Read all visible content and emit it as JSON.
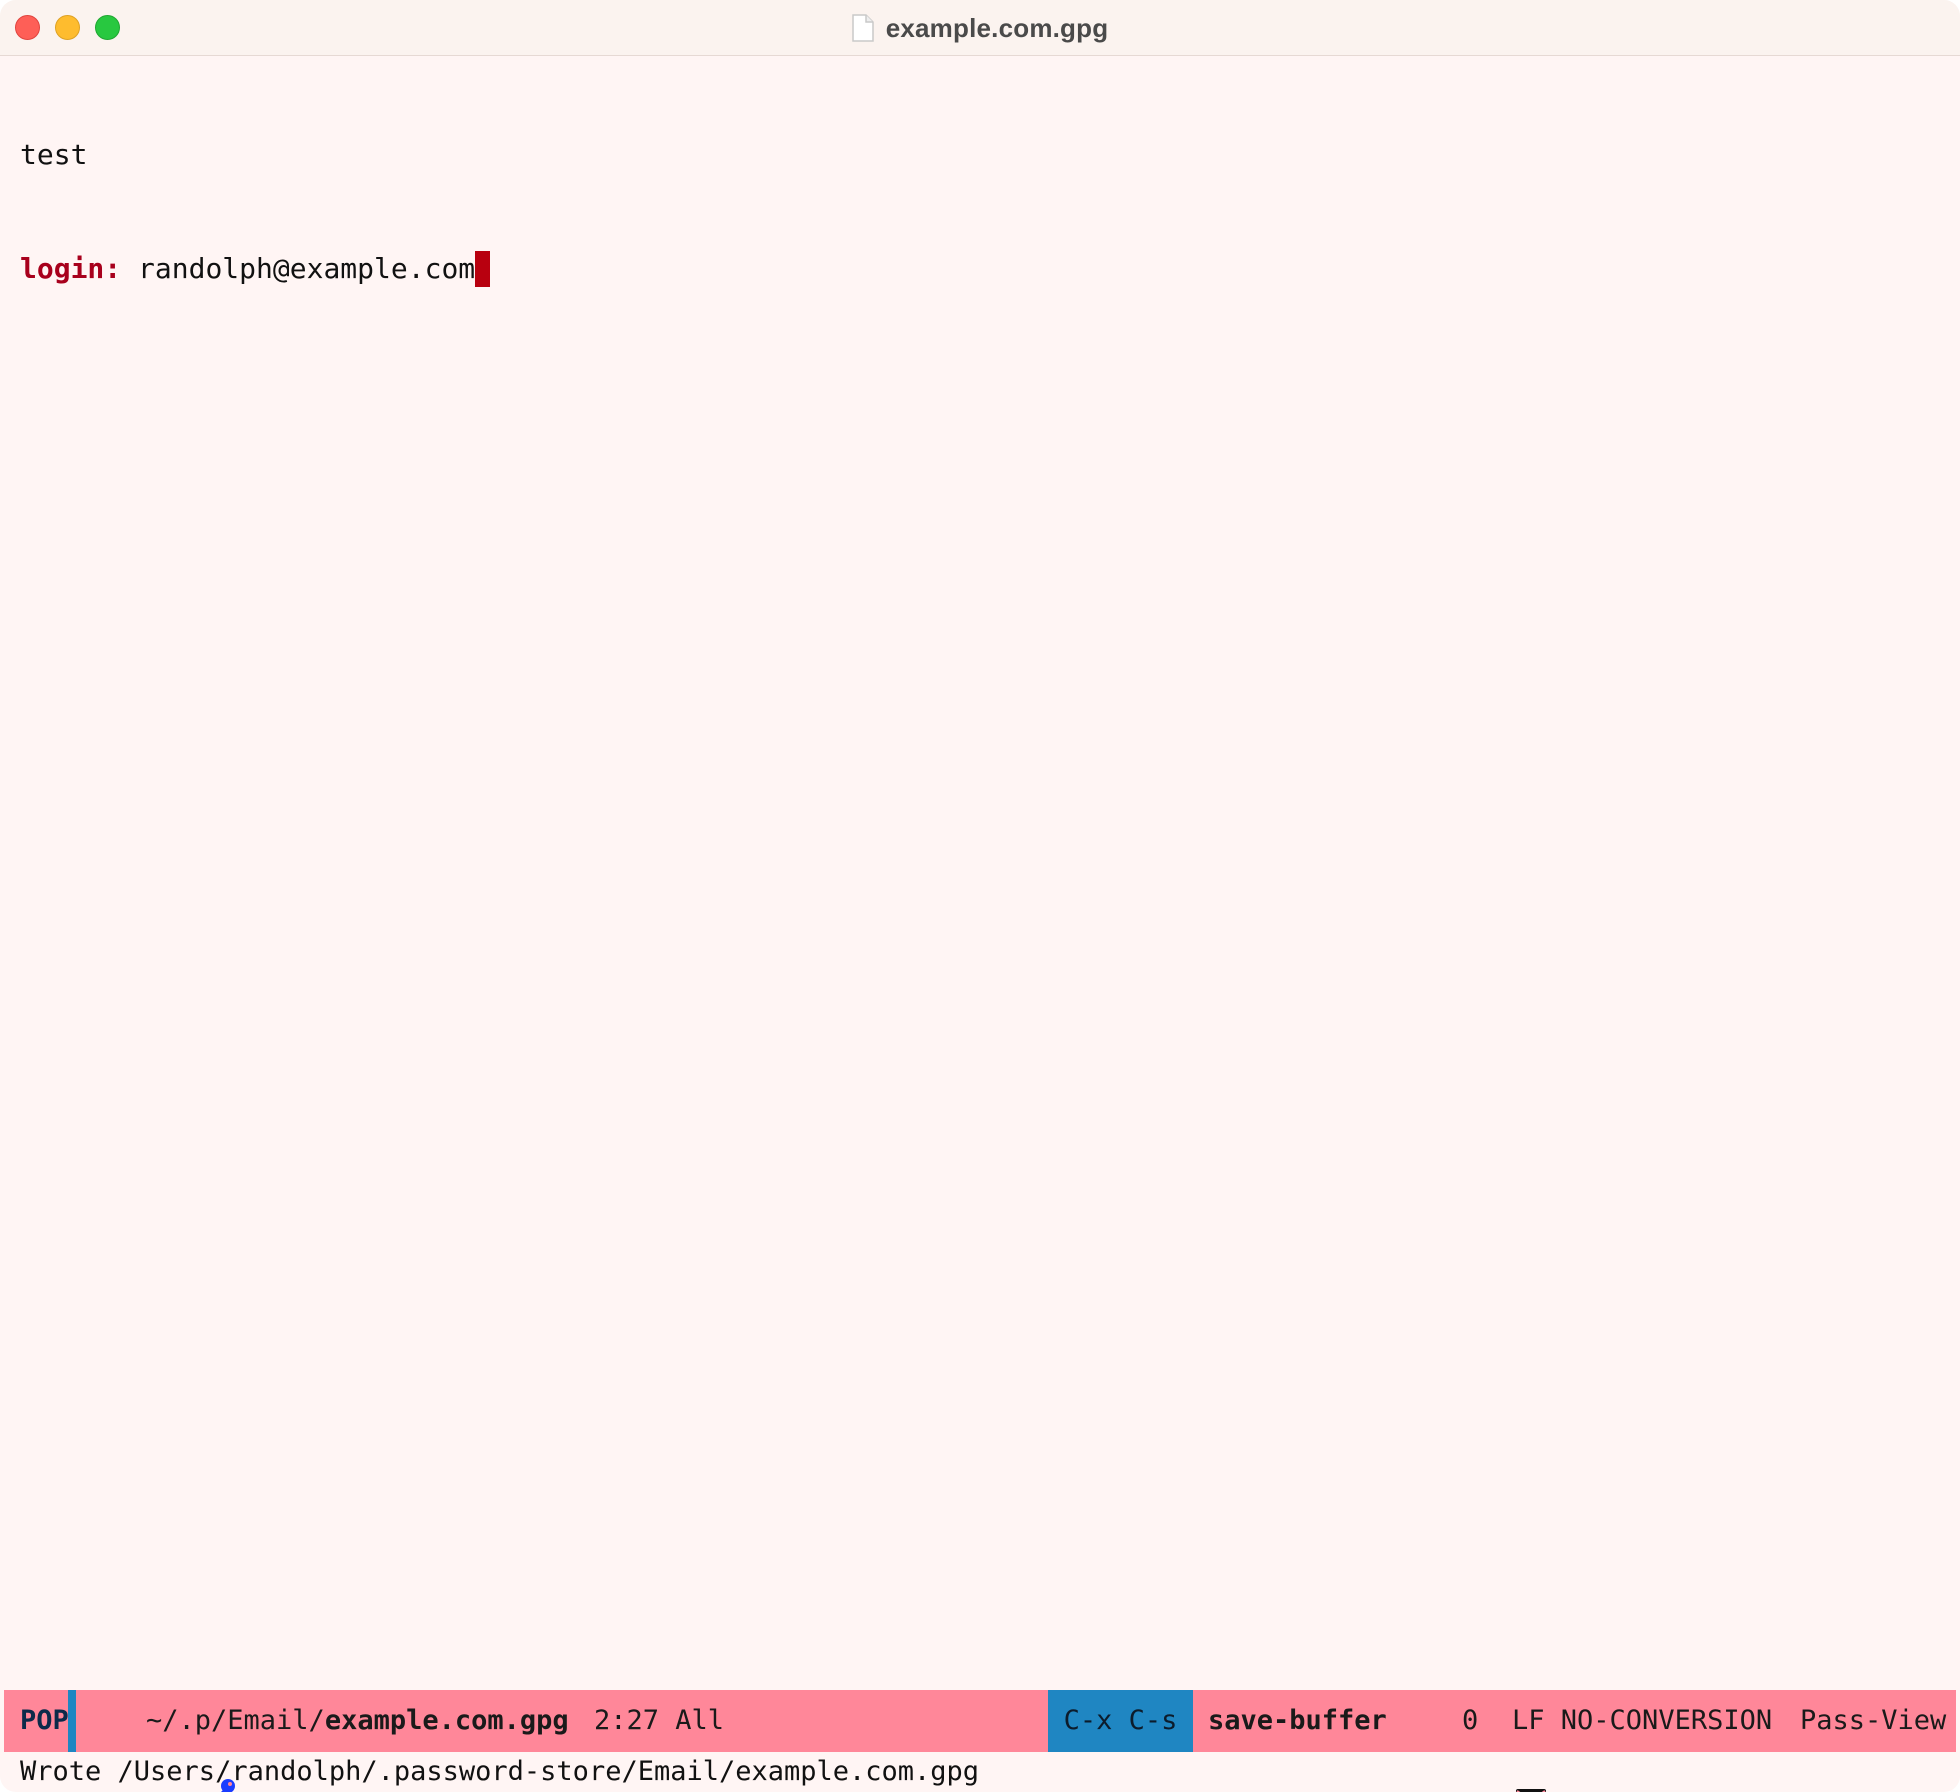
{
  "window": {
    "title": "example.com.gpg",
    "title_icon": "document-icon"
  },
  "buffer": {
    "line1": "test",
    "line2_key": "login:",
    "line2_value": " randolph@example.com",
    "cursor_position": "2:27"
  },
  "modeline": {
    "state": "POP",
    "path_prefix": "~/.p/Email/",
    "path_file": "example.com.gpg",
    "key_icon": "key-icon",
    "position": "2:27",
    "scroll": "All",
    "keybinding": "C-x C-s",
    "command": "save-buffer",
    "mail_icon": "envelope-icon",
    "mail_count": "0",
    "eol": "LF",
    "encoding": "NO-CONVERSION",
    "major_mode": "Pass-View"
  },
  "echo_area": {
    "message": "Wrote /Users/randolph/.password-store/Email/example.com.gpg"
  },
  "colors": {
    "modeline_bg": "#ff8799",
    "modeline_accent": "#1f86c2",
    "buffer_bg": "#fff5f4",
    "login_key": "#a8001c",
    "cursor": "#b8000f",
    "key_icon": "#1a3cff"
  }
}
